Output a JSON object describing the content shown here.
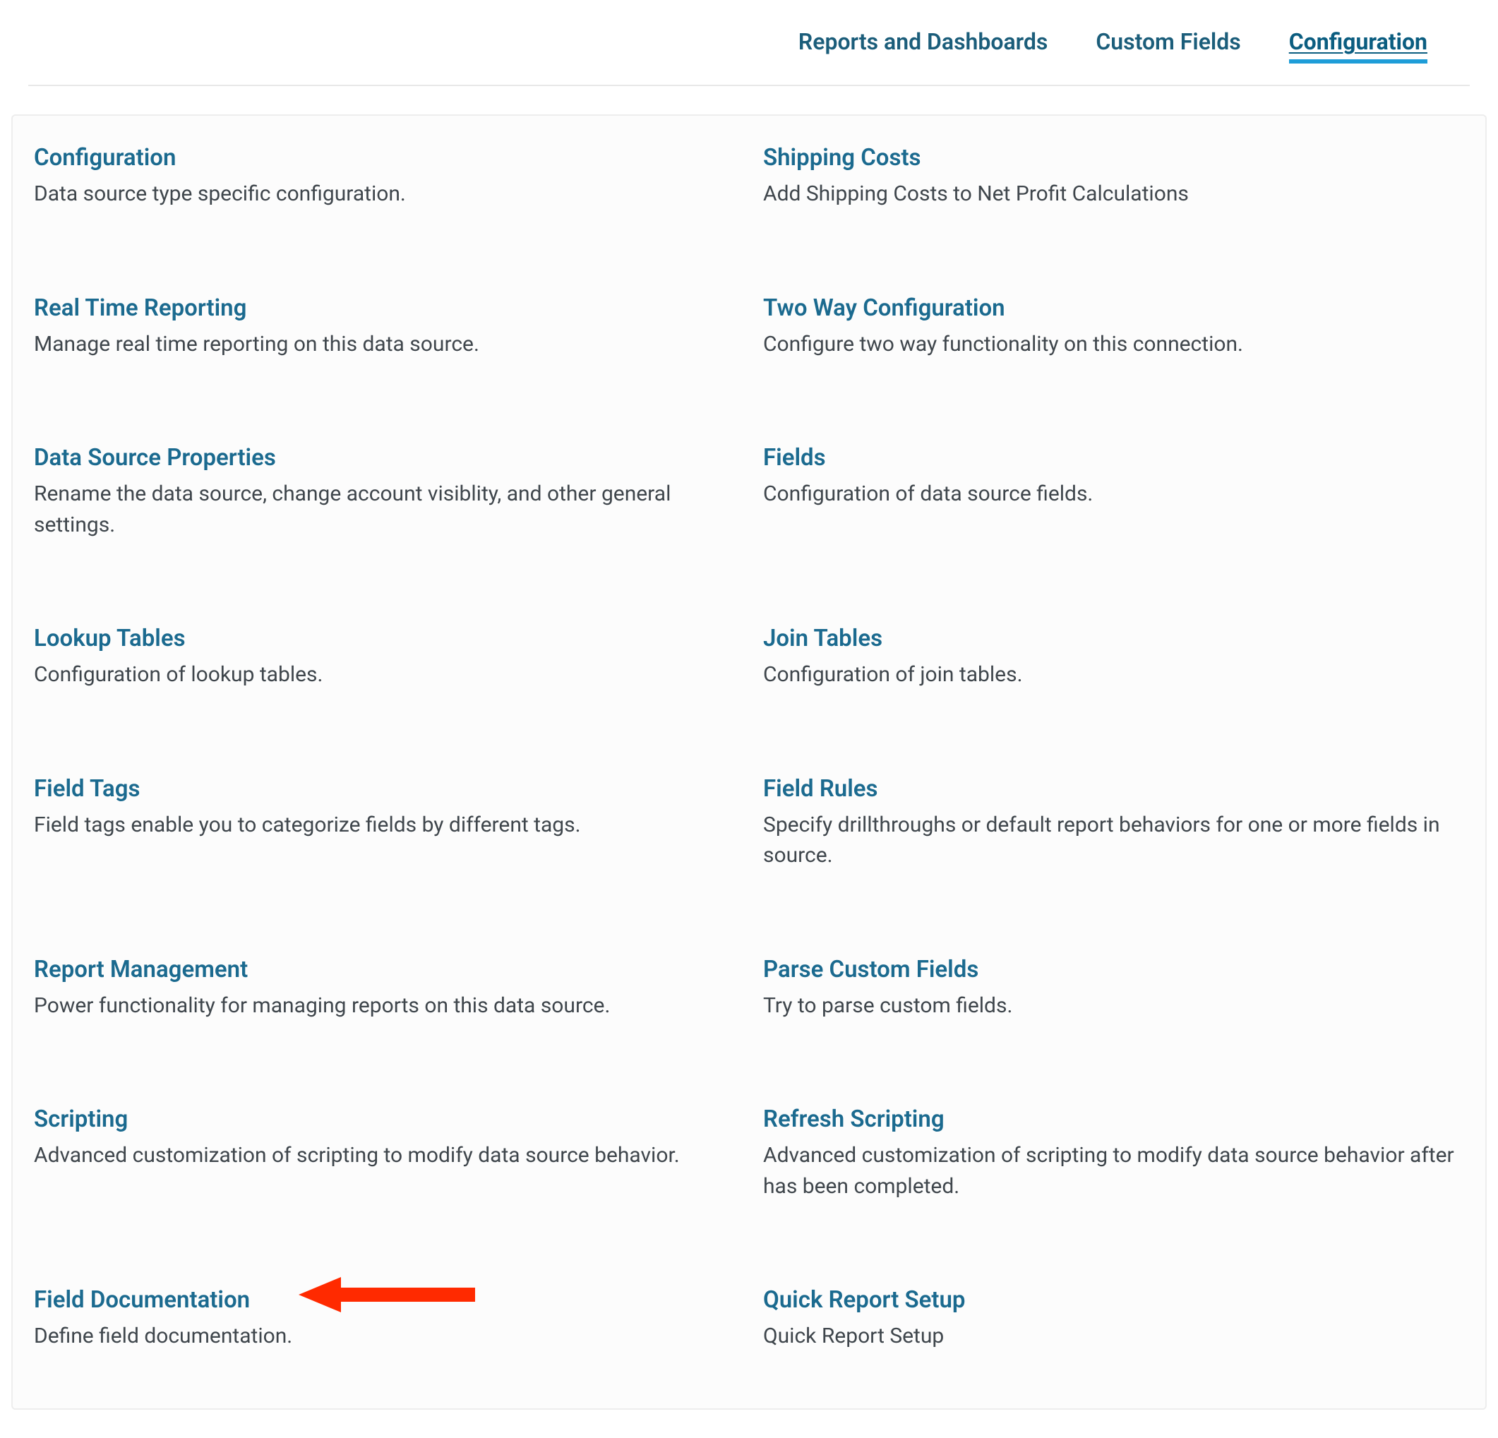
{
  "tabs": [
    {
      "label": "Reports and Dashboards",
      "active": false
    },
    {
      "label": "Custom Fields",
      "active": false
    },
    {
      "label": "Configuration",
      "active": true
    }
  ],
  "items": {
    "left": [
      {
        "title": "Configuration",
        "desc": "Data source type specific configuration."
      },
      {
        "title": "Real Time Reporting",
        "desc": "Manage real time reporting on this data source."
      },
      {
        "title": "Data Source Properties",
        "desc": "Rename the data source, change account visiblity, and other general settings."
      },
      {
        "title": "Lookup Tables",
        "desc": "Configuration of lookup tables."
      },
      {
        "title": "Field Tags",
        "desc": "Field tags enable you to categorize fields by different tags."
      },
      {
        "title": "Report Management",
        "desc": "Power functionality for managing reports on this data source."
      },
      {
        "title": "Scripting",
        "desc": "Advanced customization of scripting to modify data source behavior."
      },
      {
        "title": "Field Documentation",
        "desc": "Define field documentation."
      }
    ],
    "right": [
      {
        "title": "Shipping Costs",
        "desc": "Add Shipping Costs to Net Profit Calculations"
      },
      {
        "title": "Two Way Configuration",
        "desc": "Configure two way functionality on this connection."
      },
      {
        "title": "Fields",
        "desc": "Configuration of data source fields."
      },
      {
        "title": "Join Tables",
        "desc": "Configuration of join tables."
      },
      {
        "title": "Field Rules",
        "desc": "Specify drillthroughs or default report behaviors for one or more fields in source."
      },
      {
        "title": "Parse Custom Fields",
        "desc": "Try to parse custom fields."
      },
      {
        "title": "Refresh Scripting",
        "desc": "Advanced customization of scripting to modify data source behavior after has been completed."
      },
      {
        "title": "Quick Report Setup",
        "desc": "Quick Report Setup"
      }
    ]
  }
}
